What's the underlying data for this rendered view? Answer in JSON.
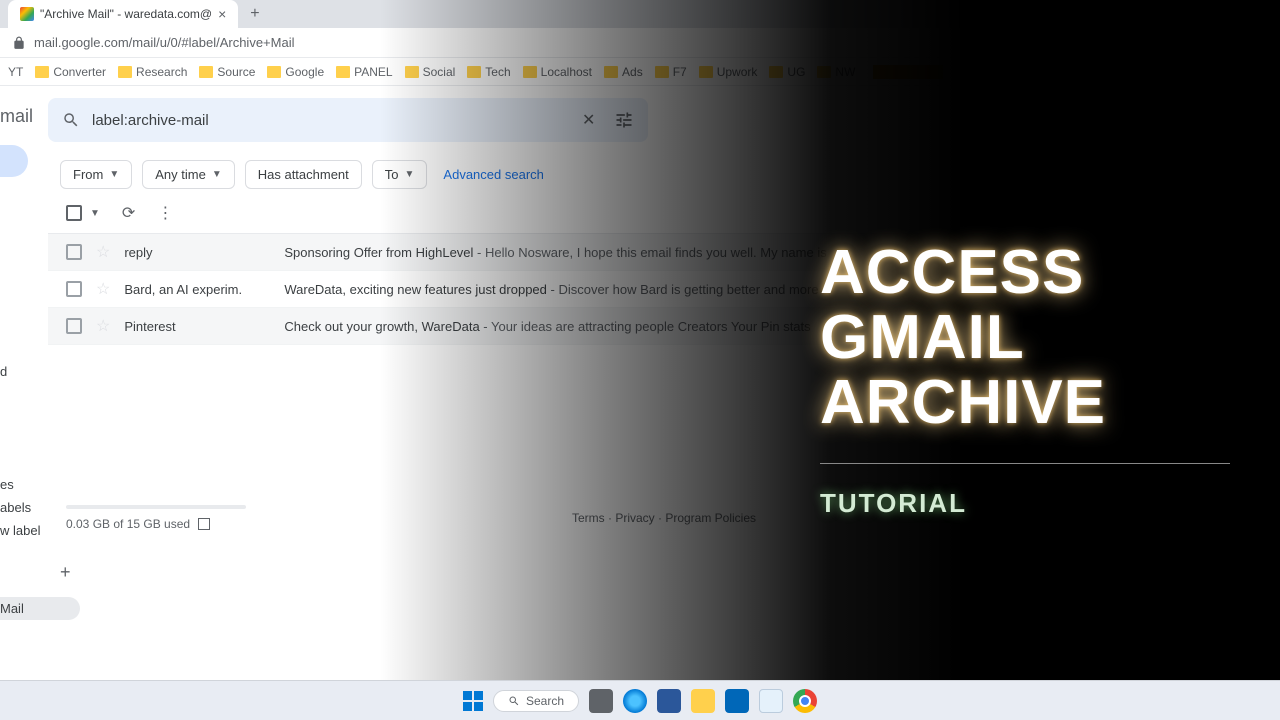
{
  "browser": {
    "tab_title": "\"Archive Mail\" - waredata.com@",
    "url": "mail.google.com/mail/u/0/#label/Archive+Mail"
  },
  "bookmarks": [
    "YT",
    "Converter",
    "Research",
    "Source",
    "Google",
    "PANEL",
    "Social",
    "Tech",
    "Localhost",
    "Ads",
    "F7",
    "Upwork",
    "UG",
    "NW"
  ],
  "gmail": {
    "app_label": "mail",
    "search_value": "label:archive-mail",
    "filters": {
      "from": "From",
      "anytime": "Any time",
      "has_attachment": "Has attachment",
      "to": "To",
      "advanced": "Advanced search"
    },
    "emails": [
      {
        "sender": "reply",
        "subject": "Sponsoring Offer from HighLevel",
        "snippet": " - Hello Nosware, I hope this email finds you well. My name is"
      },
      {
        "sender": "Bard, an AI experim.",
        "subject": "WareData, exciting new features just dropped",
        "snippet": " - Discover how Bard is getting better and more"
      },
      {
        "sender": "Pinterest",
        "subject": "Check out your growth, WareData",
        "snippet": " - Your ideas are attracting people Creators Your Pin stats"
      }
    ],
    "sidebar": {
      "item1": "d",
      "categories": "es",
      "labels": "abels",
      "new_label": "w label",
      "archive_mail": "Mail"
    },
    "storage": "0.03 GB of 15 GB used",
    "footer": {
      "terms": "Terms",
      "privacy": "Privacy",
      "policies": "Program Policies"
    }
  },
  "overlay": {
    "line1": "ACCESS",
    "line2": "GMAIL",
    "line3": "ARCHIVE",
    "sub": "TUTORIAL"
  },
  "taskbar": {
    "search": "Search"
  }
}
